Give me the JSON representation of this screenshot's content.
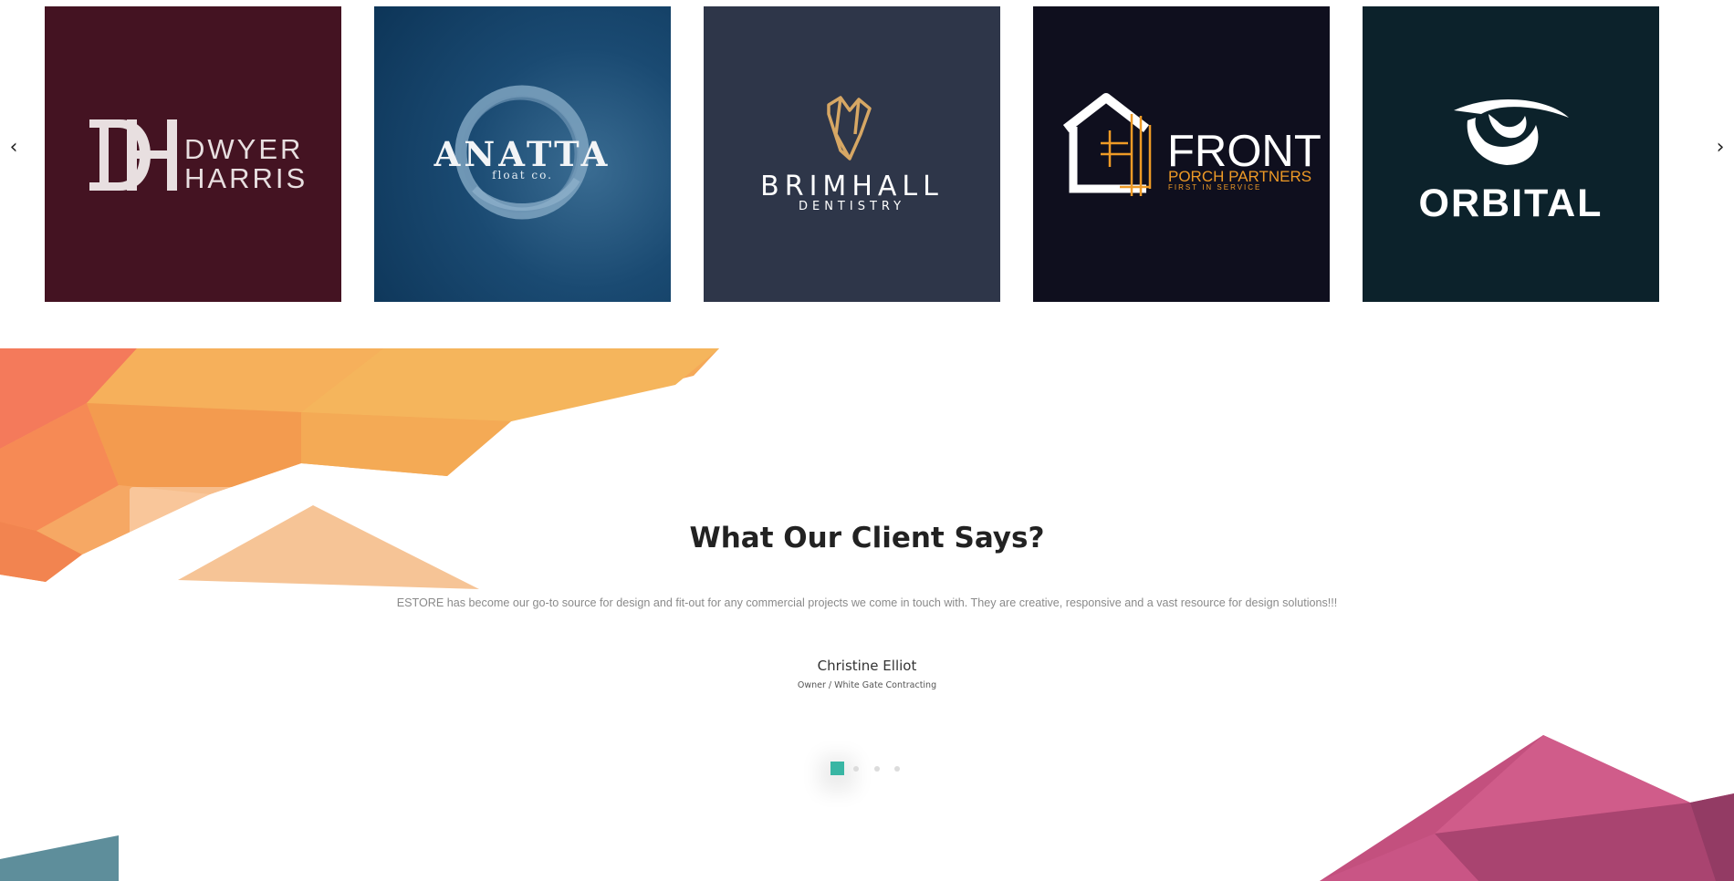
{
  "carousel": {
    "prev_icon": "‹",
    "next_icon": "›",
    "logos": [
      {
        "name_line1": "DWYER",
        "name_line2": "HARRIS",
        "monogram": "DH",
        "background": "#441322"
      },
      {
        "name": "ANATTA",
        "sub": "float co.",
        "background": "#1a4a72"
      },
      {
        "name": "BRIMHALL",
        "sub": "DENTISTRY",
        "background": "#2e3649"
      },
      {
        "name": "FRONT",
        "sub": "PORCH PARTNERS",
        "tagline": "FIRST IN SERVICE",
        "background": "#0f0f1e",
        "accent": "#ee9a26"
      },
      {
        "name": "ORBITAL",
        "background": "#0c222b"
      }
    ]
  },
  "testimonials": {
    "title": "What Our Client Says?",
    "quote": "ESTORE has become our go-to source for design and fit-out for any commercial projects we come in touch with. They are creative, responsive and a vast resource for design solutions!!!",
    "author": "Christine Elliot",
    "role": "Owner / White Gate Contracting",
    "active_dot_color": "#39b6a4",
    "dot_count": 4,
    "active_index": 0
  }
}
